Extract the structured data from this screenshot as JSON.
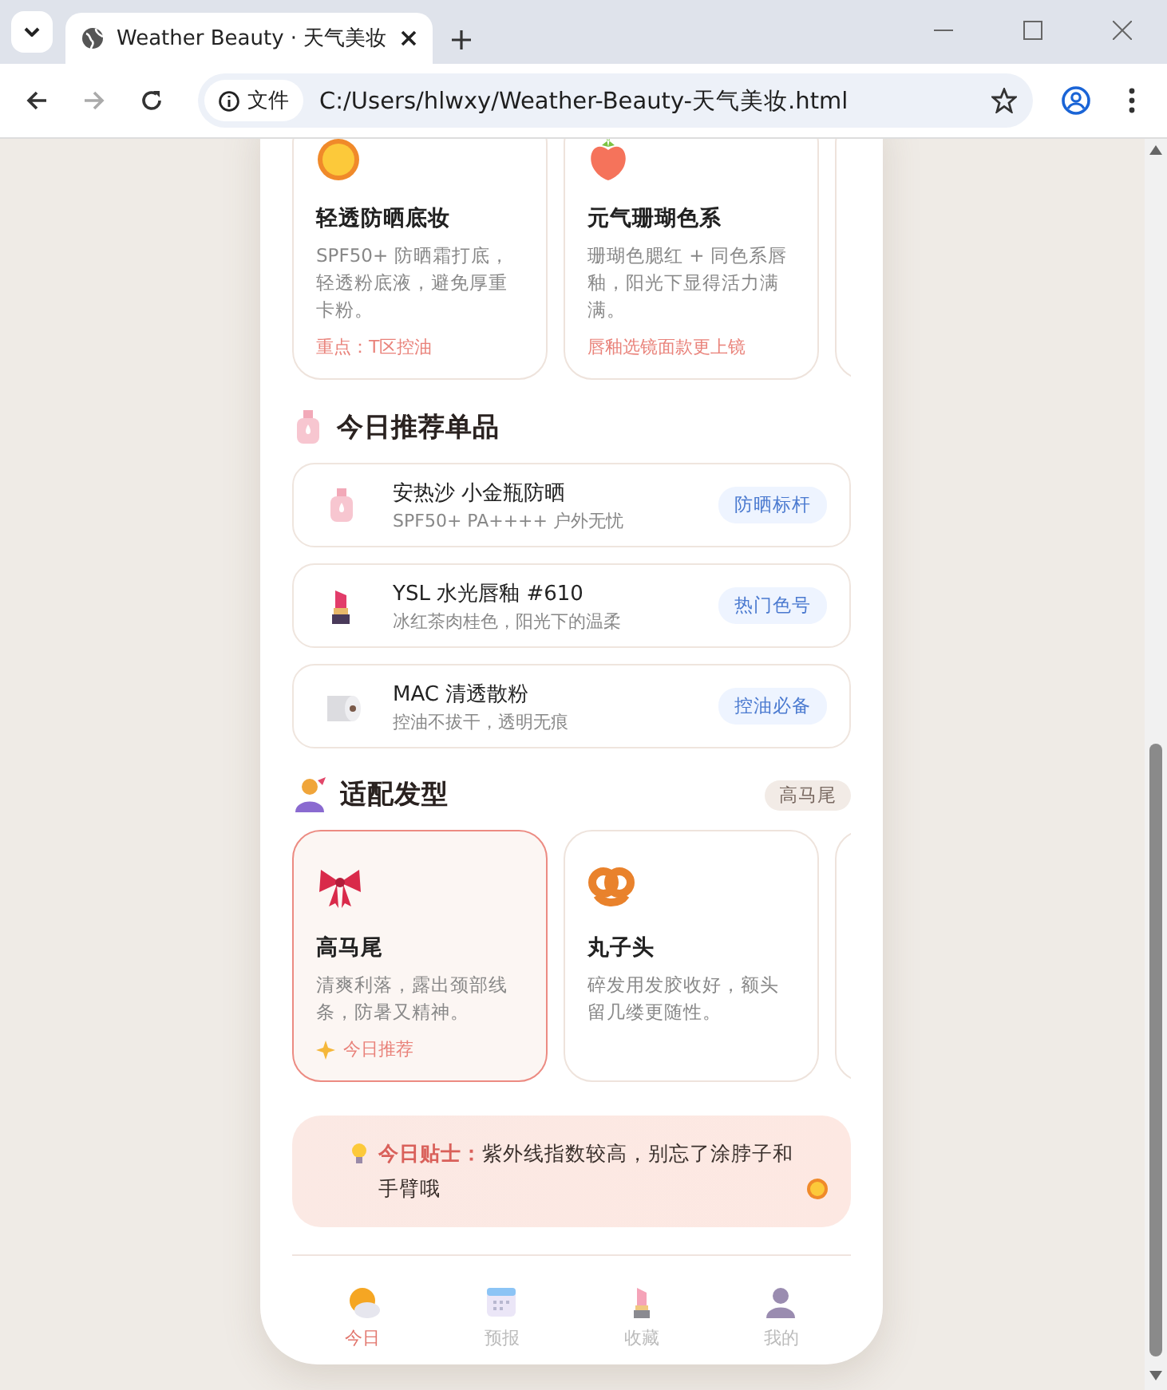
{
  "browser": {
    "tab_title": "Weather Beauty · 天气美妆",
    "address_label": "文件",
    "url": "C:/Users/hlwxy/Weather-Beauty-天气美妆.html"
  },
  "style_cards": [
    {
      "title": "轻透防晒底妆",
      "desc": "SPF50+ 防晒霜打底，轻透粉底液，避免厚重卡粉。",
      "tip": "重点：T区控油"
    },
    {
      "title": "元气珊瑚色系",
      "desc": "珊瑚色腮红 + 同色系唇釉，阳光下显得活力满满。",
      "tip": "唇釉选镜面款更上镜"
    }
  ],
  "products_section": {
    "title": "今日推荐单品"
  },
  "products": [
    {
      "name": "安热沙 小金瓶防晒",
      "desc": "SPF50+ PA++++ 户外无忧",
      "tag": "防晒标杆"
    },
    {
      "name": "YSL 水光唇釉 #610",
      "desc": "冰红茶肉桂色，阳光下的温柔",
      "tag": "热门色号"
    },
    {
      "name": "MAC 清透散粉",
      "desc": "控油不拔干，透明无痕",
      "tag": "控油必备"
    }
  ],
  "hair_section": {
    "title": "适配发型",
    "tag": "高马尾"
  },
  "hair_cards": [
    {
      "title": "高马尾",
      "desc": "清爽利落，露出颈部线条，防暑又精神。",
      "badge": "今日推荐",
      "selected": true
    },
    {
      "title": "丸子头",
      "desc": "碎发用发胶收好，额头留几缕更随性。",
      "selected": false
    }
  ],
  "tip": {
    "text": "**今日贴士：**紫外线指数较高，别忘了涂脖子和手臂哦"
  },
  "nav": [
    {
      "label": "今日",
      "selected": true
    },
    {
      "label": "预报",
      "selected": false
    },
    {
      "label": "收藏",
      "selected": false
    },
    {
      "label": "我的",
      "selected": false
    }
  ]
}
